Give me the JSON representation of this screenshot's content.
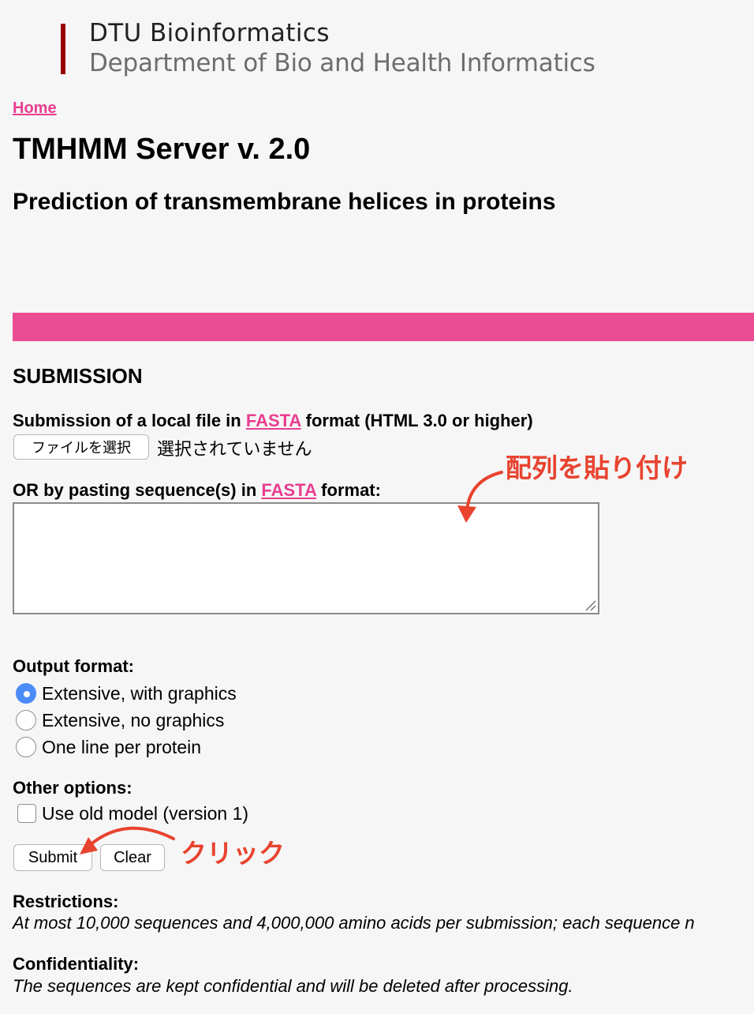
{
  "header": {
    "logo_title": "DTU Bioinformatics",
    "logo_subtitle": "Department of Bio and Health Informatics"
  },
  "breadcrumb": {
    "home": "Home"
  },
  "page": {
    "title": "TMHMM Server v. 2.0",
    "subtitle": "Prediction of transmembrane helices in proteins"
  },
  "submission": {
    "heading": "SUBMISSION",
    "file_label_prefix": "Submission of a local file in ",
    "file_label_link": "FASTA",
    "file_label_suffix": " format (HTML 3.0 or higher)",
    "file_button": "ファイルを選択",
    "file_status": "選択されていません",
    "paste_label_prefix": "OR by pasting sequence(s) in ",
    "paste_label_link": "FASTA",
    "paste_label_suffix": " format:",
    "sequence_value": ""
  },
  "output_format": {
    "label": "Output format:",
    "options": [
      {
        "label": "Extensive, with graphics",
        "checked": true
      },
      {
        "label": "Extensive, no graphics",
        "checked": false
      },
      {
        "label": "One line per protein",
        "checked": false
      }
    ]
  },
  "other_options": {
    "label": "Other options:",
    "old_model": {
      "label": "Use old model (version 1)",
      "checked": false
    }
  },
  "buttons": {
    "submit": "Submit",
    "clear": "Clear"
  },
  "restrictions": {
    "label": "Restrictions:",
    "text": "At most 10,000 sequences and 4,000,000 amino acids per submission; each sequence n"
  },
  "confidentiality": {
    "label": "Confidentiality:",
    "text": "The sequences are kept confidential and will be deleted after processing."
  },
  "annotations": {
    "paste_hint": "配列を貼り付け",
    "click_hint": "クリック",
    "color": "#e8432f"
  },
  "colors": {
    "accent_pink": "#ea4c94",
    "link_pink": "#e93d8f",
    "logo_red": "#990000",
    "radio_blue": "#4a8cf7"
  }
}
